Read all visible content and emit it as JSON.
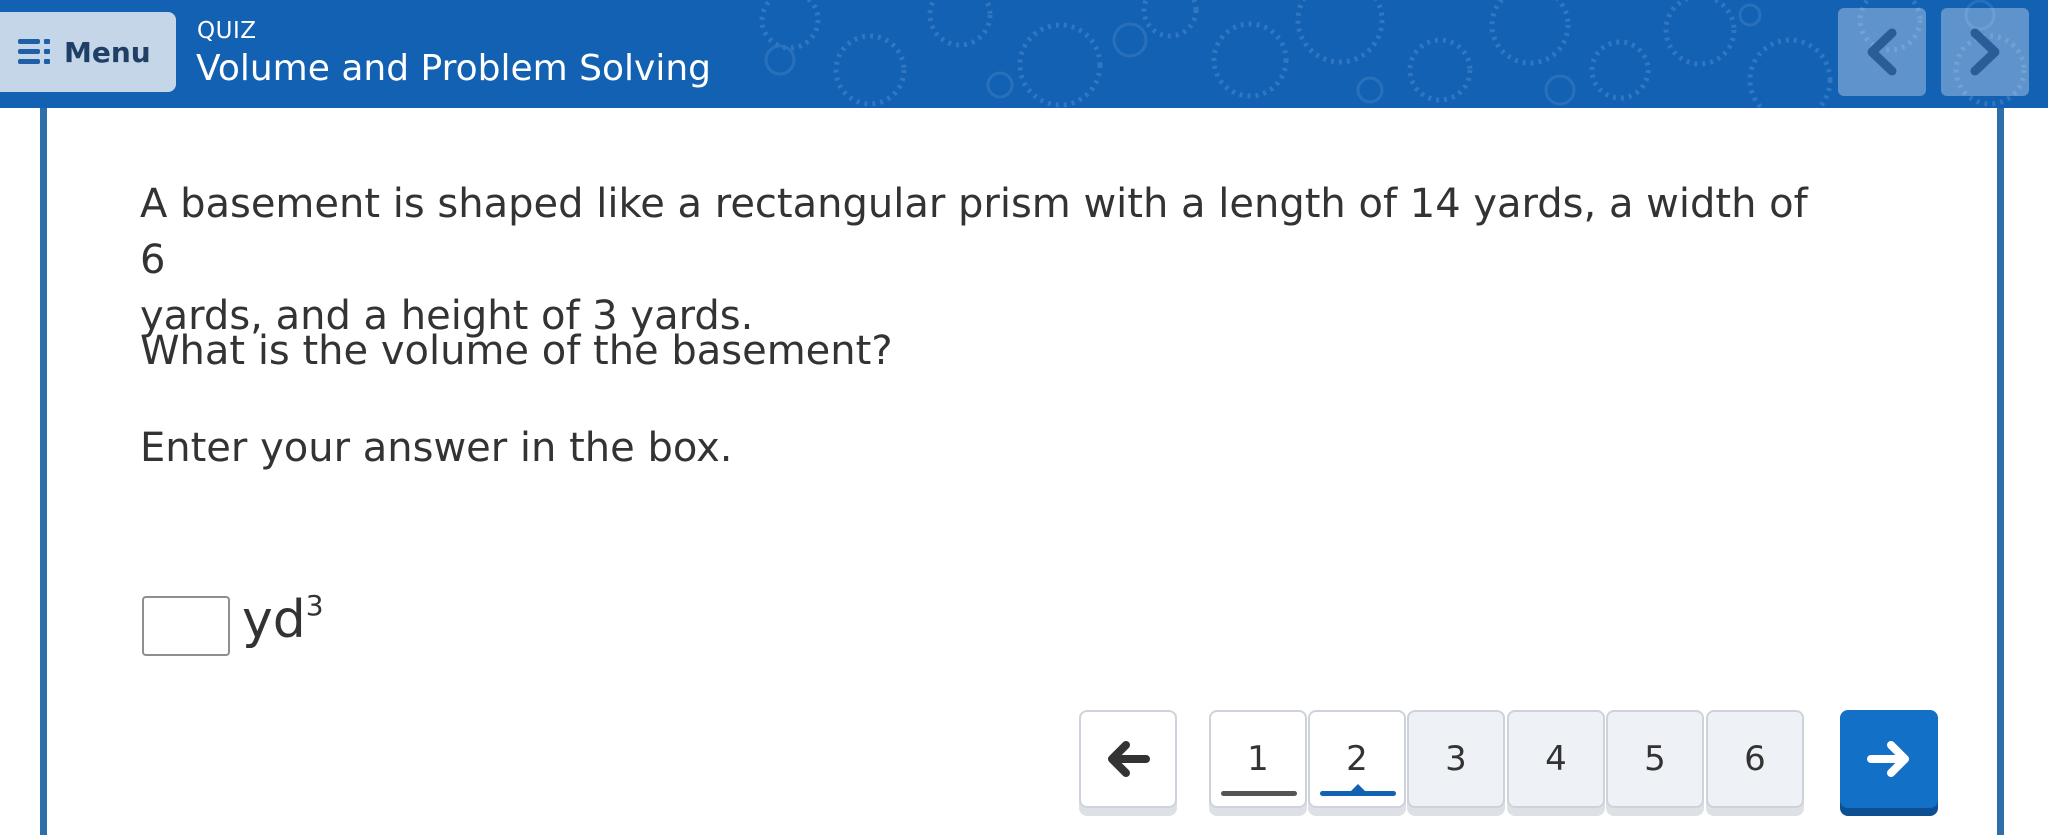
{
  "header": {
    "menu_label": "Menu",
    "quiz_label": "QUIZ",
    "title": "Volume and Problem Solving"
  },
  "question": {
    "line1": "A basement is shaped like a rectangular prism with a length of 14 yards, a width of 6",
    "line2": "yards, and a height of 3 yards.",
    "prompt": "What is the volume of the basement?",
    "instruction": "Enter your answer in the box."
  },
  "answer": {
    "value": "",
    "unit": "yd",
    "unit_exponent": "3"
  },
  "pager": {
    "pages": [
      "1",
      "2",
      "3",
      "4",
      "5",
      "6"
    ],
    "current": "2"
  },
  "colors": {
    "header_bg": "#1261b3",
    "accent": "#1270c6"
  },
  "icons": {
    "menu": "list-icon",
    "prev_header": "chevron-left-icon",
    "next_header": "chevron-right-icon",
    "back": "arrow-left-icon",
    "forward": "arrow-right-icon"
  }
}
